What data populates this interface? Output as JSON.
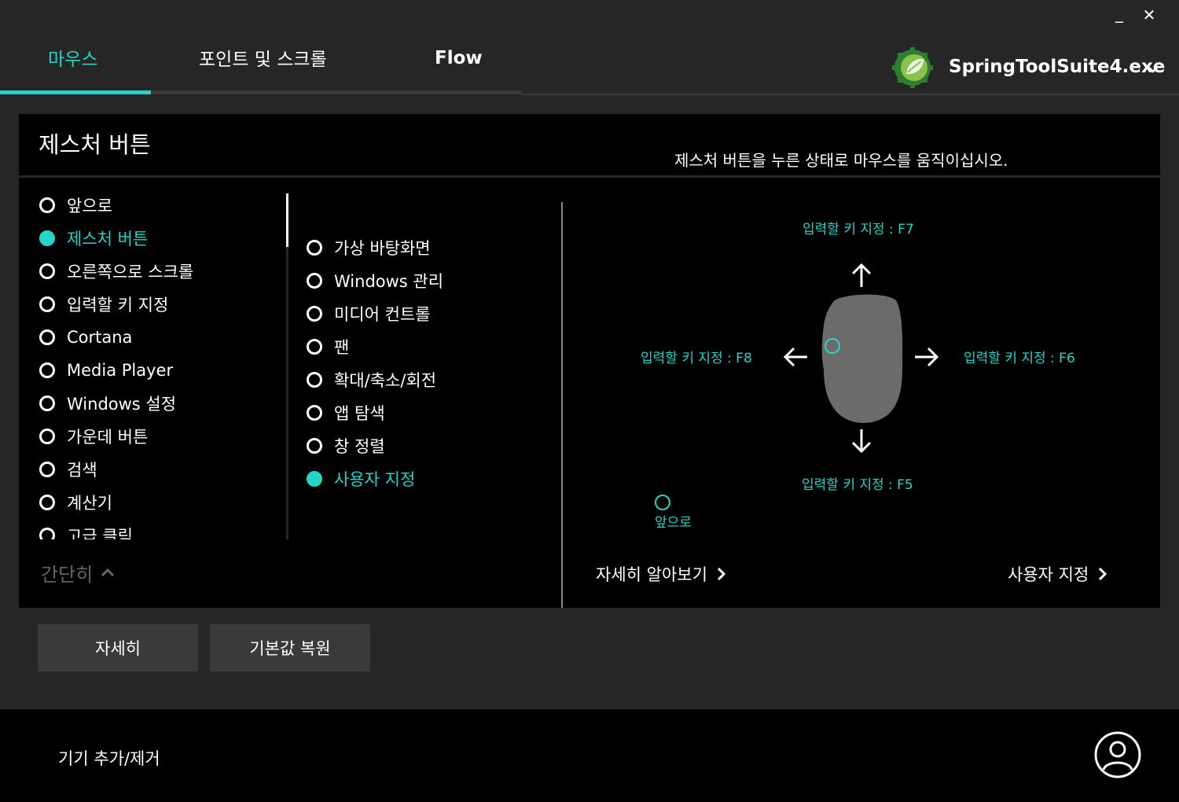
{
  "window": {
    "minimize_glyph": "_",
    "close_glyph": "✕"
  },
  "tabs": [
    {
      "label": "마우스"
    },
    {
      "label": "포인트 및 스크롤"
    },
    {
      "label": "Flow"
    }
  ],
  "app_selector": {
    "label": "SpringToolSuite4.exe",
    "icon": "spring-leaf-icon",
    "chevron": "chevron-down-icon"
  },
  "panel": {
    "title": "제스처 버튼",
    "hint": "제스처 버튼을 누른 상태로 마우스를 움직이십시오.",
    "button_list": [
      {
        "label": "앞으로"
      },
      {
        "label": "제스처 버튼"
      },
      {
        "label": "오른쪽으로 스크롤"
      },
      {
        "label": "입력할 키 지정"
      },
      {
        "label": "Cortana"
      },
      {
        "label": "Media Player"
      },
      {
        "label": "Windows 설정"
      },
      {
        "label": "가운데 버튼"
      },
      {
        "label": "검색"
      },
      {
        "label": "계산기"
      },
      {
        "label": "고급 클릭"
      }
    ],
    "collapse_label": "간단히",
    "gesture_list": [
      {
        "label": "가상 바탕화면"
      },
      {
        "label": "Windows 관리"
      },
      {
        "label": "미디어 컨트롤"
      },
      {
        "label": "팬"
      },
      {
        "label": "확대/축소/회전"
      },
      {
        "label": "앱 탐색"
      },
      {
        "label": "창 정렬"
      },
      {
        "label": "사용자 지정"
      }
    ],
    "gesture_map": {
      "up": "입력할 키 지정 : F7",
      "left": "입력할 키 지정 : F8",
      "right": "입력할 키 지정 : F6",
      "down": "입력할 키 지정 : F5",
      "button_marker": "앞으로"
    },
    "learn_more": "자세히 알아보기",
    "customize": "사용자 지정"
  },
  "actions": {
    "more": "자세히",
    "restore": "기본값 복원"
  },
  "footer": {
    "add_remove": "기기 추가/제거",
    "account_icon": "account-icon"
  },
  "colors": {
    "accent": "#23d6c8",
    "background": "#262626",
    "panel": "#000000",
    "button": "#3a3a3a"
  }
}
